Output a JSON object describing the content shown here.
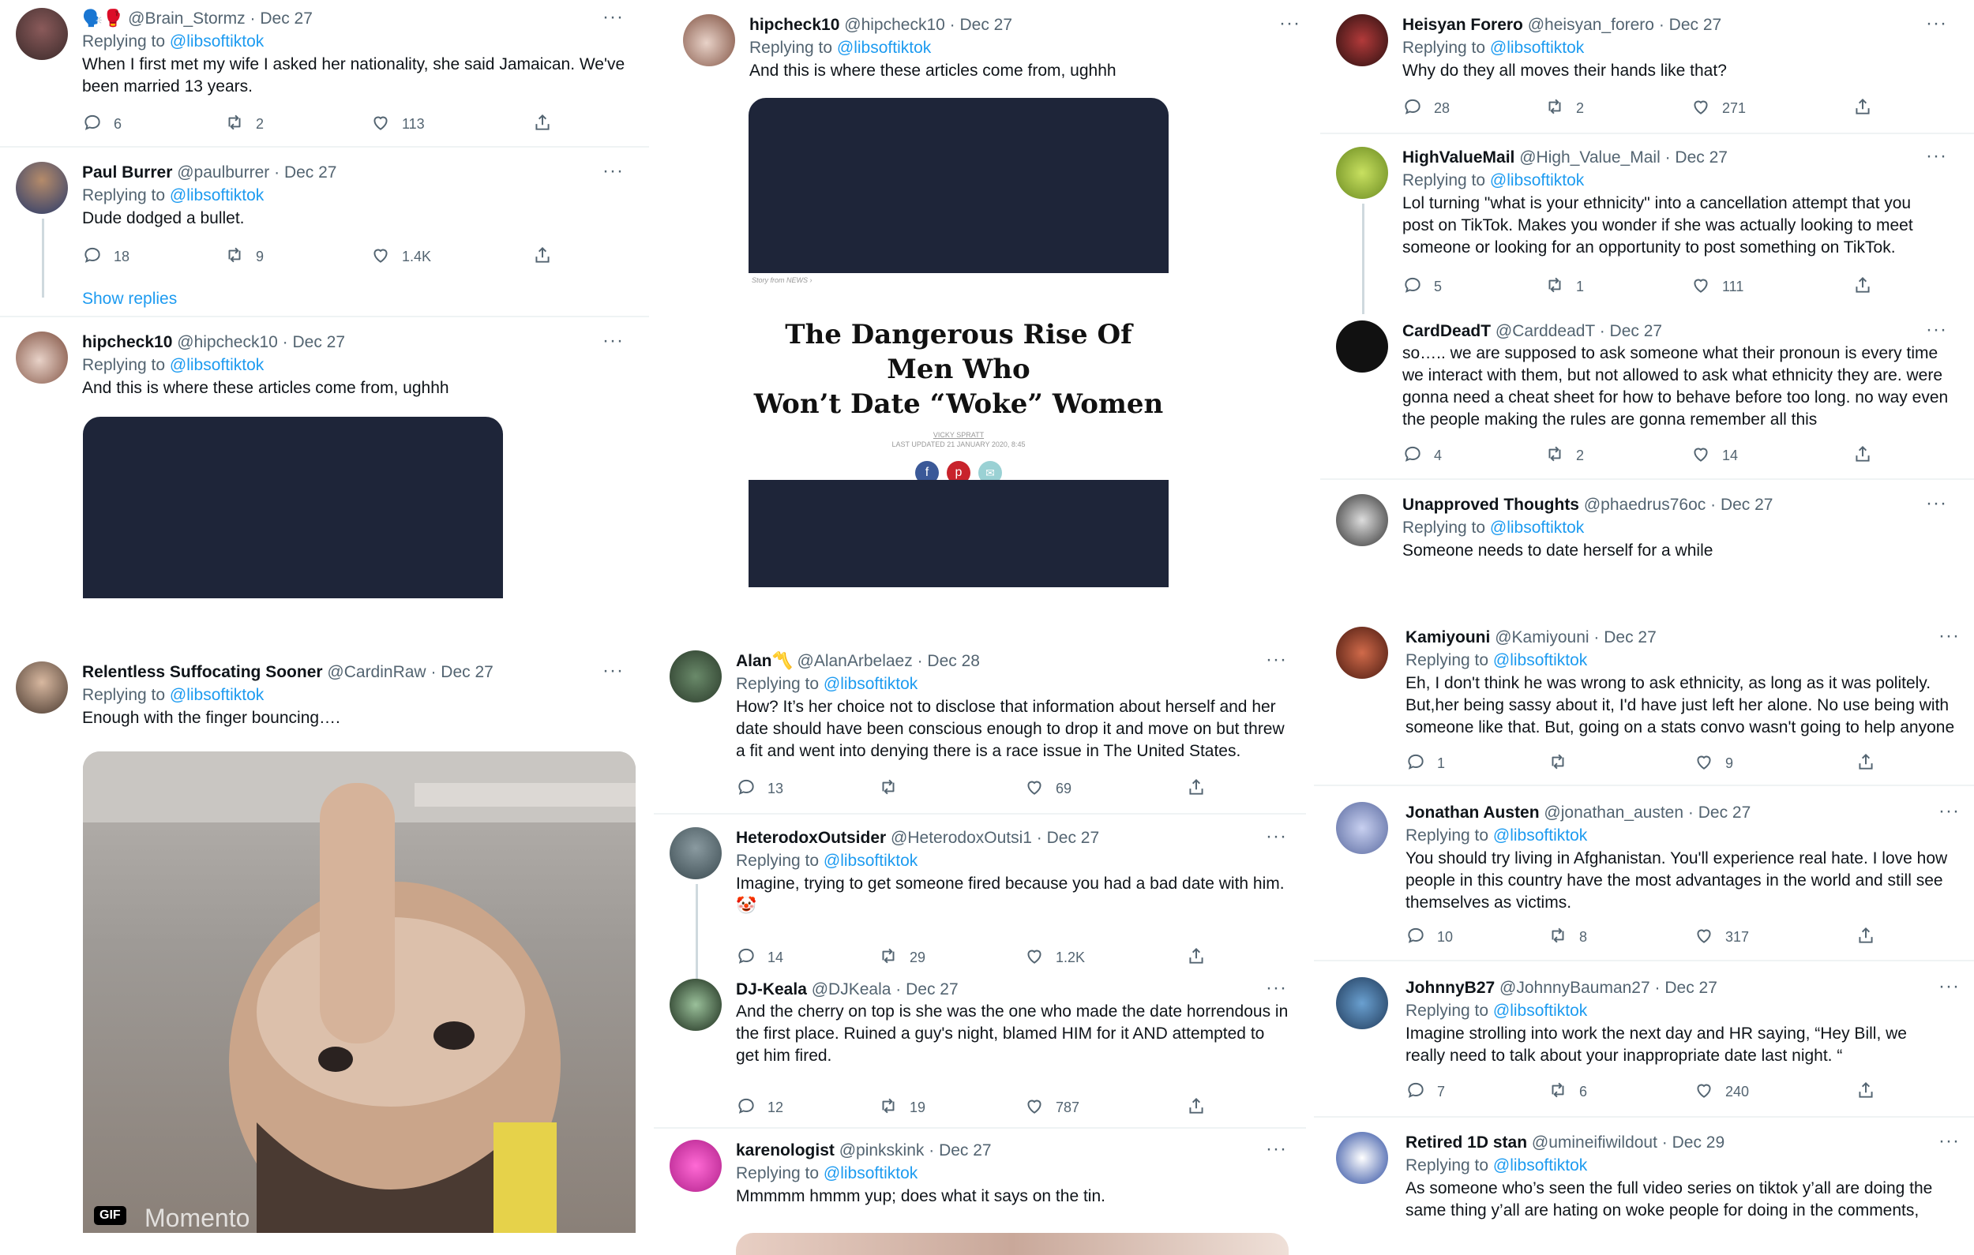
{
  "reply_to_prefix": "Replying to",
  "reply_handle": "@libsoftiktok",
  "show_replies_label": "Show replies",
  "gif_badge": "GIF",
  "gif_watermark": "Momento",
  "article": {
    "breadcrumb": "Story from NEWS ›",
    "title_line1": "The Dangerous Rise Of Men Who",
    "title_line2": "Won’t Date “Woke” Women",
    "author": "VICKY SPRATT",
    "updated": "LAST UPDATED 21 JANUARY 2020, 8:45"
  },
  "colors": {
    "accent": "#1d9bf0",
    "text": "#0f1419",
    "muted": "#536471",
    "dark_media": "#1e2539"
  },
  "tweets": [
    {
      "id": "brain",
      "name": "",
      "handle": "@Brain_Stormz",
      "date": "Dec 27",
      "text": "When I first met my wife I asked her nationality, she said Jamaican. We've been married 13 years.",
      "replies": "6",
      "retweets": "2",
      "likes": "113"
    },
    {
      "id": "paul",
      "name": "Paul Burrer",
      "handle": "@paulburrer",
      "date": "Dec 27",
      "text": "Dude dodged a bullet.",
      "replies": "18",
      "retweets": "9",
      "likes": "1.4K"
    },
    {
      "id": "hip1",
      "name": "hipcheck10",
      "handle": "@hipcheck10",
      "date": "Dec 27",
      "text": "And this is where these articles come from, ughhh"
    },
    {
      "id": "hip2",
      "name": "hipcheck10",
      "handle": "@hipcheck10",
      "date": "Dec 27",
      "text": "And this is where these articles come from, ughhh"
    },
    {
      "id": "heisyan",
      "name": "Heisyan Forero",
      "handle": "@heisyan_forero",
      "date": "Dec 27",
      "text": "Why do they all moves their hands like that?",
      "replies": "28",
      "retweets": "2",
      "likes": "271"
    },
    {
      "id": "hvm",
      "name": "HighValueMail",
      "handle": "@High_Value_Mail",
      "date": "Dec 27",
      "text": "Lol turning \"what is your ethnicity\" into a cancellation attempt that you post on TikTok. Makes you wonder if she was actually looking to meet someone or looking for an opportunity to post something on TikTok.",
      "replies": "5",
      "retweets": "1",
      "likes": "111"
    },
    {
      "id": "card",
      "name": "CardDeadT",
      "handle": "@CarddeadT",
      "date": "Dec 27",
      "text": "so….. we are supposed to ask someone what their pronoun is every time we interact with them, but not allowed to ask what ethnicity they are. were gonna need a cheat sheet for how to behave before too long. no way even the people making the rules are gonna remember all this",
      "replies": "4",
      "retweets": "2",
      "likes": "14"
    },
    {
      "id": "unapp",
      "name": "Unapproved Thoughts",
      "handle": "@phaedrus76oc",
      "date": "Dec 27",
      "text": "Someone needs to date herself for a while"
    },
    {
      "id": "rss",
      "name": "Relentless Suffocating Sooner",
      "handle": "@CardinRaw",
      "date": "Dec 27",
      "text": "Enough with the finger bouncing…."
    },
    {
      "id": "alan",
      "name": "Alan〽️",
      "handle": "@AlanArbelaez",
      "date": "Dec 28",
      "text": "How? It’s her choice not to disclose that information about herself and her date should have been conscious enough to drop it and move on but threw a fit and went into denying there is a race issue in The United States.",
      "replies": "13",
      "retweets": "",
      "likes": "69"
    },
    {
      "id": "hetero",
      "name": "HeterodoxOutsider",
      "handle": "@HeterodoxOutsi1",
      "date": "Dec 27",
      "text": "Imagine, trying to get someone fired because you had a bad date with him.",
      "emoji": "🤡",
      "replies": "14",
      "retweets": "29",
      "likes": "1.2K"
    },
    {
      "id": "djk",
      "name": "DJ-Keala",
      "handle": "@DJKeala",
      "date": "Dec 27",
      "text": "And the cherry on top is she was the one who made the date horrendous in the first place. Ruined a guy's night, blamed HIM for it AND attempted to get him fired.",
      "replies": "12",
      "retweets": "19",
      "likes": "787"
    },
    {
      "id": "karen",
      "name": "karenologist",
      "handle": "@pinkskink",
      "date": "Dec 27",
      "text": "Mmmmm hmmm yup; does what it says on the tin."
    },
    {
      "id": "kami",
      "name": "Kamiyouni",
      "handle": "@Kamiyouni",
      "date": "Dec 27",
      "text": "Eh, I don't think he was wrong to ask ethnicity, as long as it was politely. But,her being sassy about it, I'd have just left her alone. No use being with someone like that. But, going on a stats convo wasn't going to help anyone",
      "replies": "1",
      "retweets": "",
      "likes": "9"
    },
    {
      "id": "jon",
      "name": "Jonathan Austen",
      "handle": "@jonathan_austen",
      "date": "Dec 27",
      "text": "You should try living in Afghanistan. You'll experience real hate. I love how people in this country have the most advantages in the world and still see themselves as victims.",
      "replies": "10",
      "retweets": "8",
      "likes": "317"
    },
    {
      "id": "johnny",
      "name": "JohnnyB27",
      "handle": "@JohnnyBauman27",
      "date": "Dec 27",
      "text": "Imagine strolling into work the next day and HR saying, “Hey Bill, we really need to talk about your inappropriate date last night. “",
      "replies": "7",
      "retweets": "6",
      "likes": "240"
    },
    {
      "id": "ret1d",
      "name": "Retired 1D stan",
      "handle": "@umineifiwildout",
      "date": "Dec 29",
      "text": "As someone who’s seen the full video series on tiktok y’all are doing the same thing y’all are hating on woke people for doing in the comments,"
    }
  ]
}
